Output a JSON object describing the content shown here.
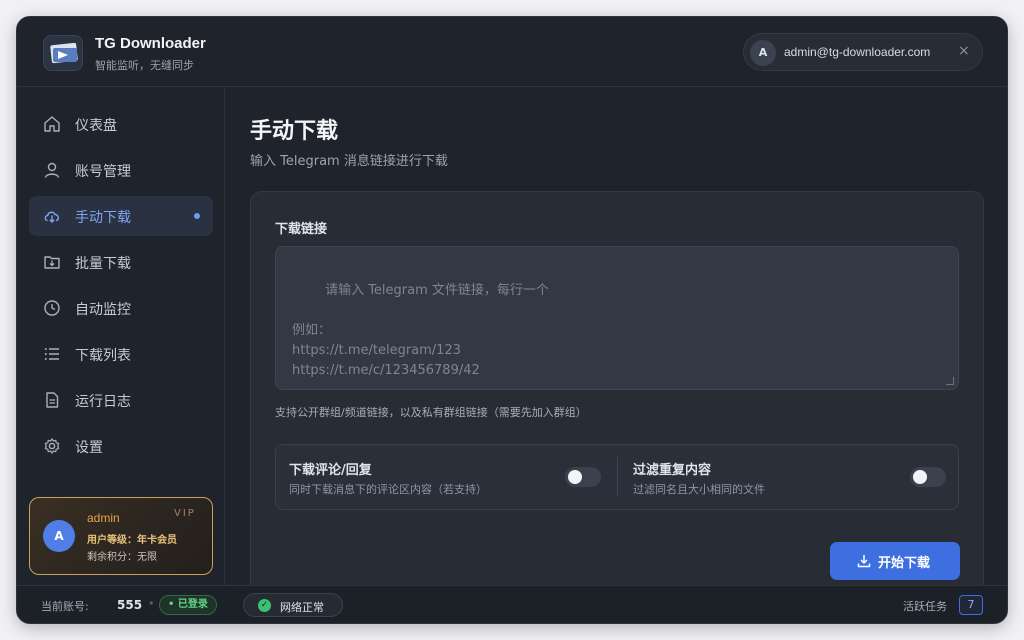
{
  "app": {
    "title": "TG Downloader",
    "subtitle": "智能监听，无缝同步"
  },
  "user": {
    "avatar_initial": "A",
    "email": "admin@tg-downloader.com",
    "close_glyph": "×"
  },
  "sidebar": {
    "items": [
      {
        "label": "仪表盘",
        "icon": "home-icon",
        "active": false
      },
      {
        "label": "账号管理",
        "icon": "user-icon",
        "active": false
      },
      {
        "label": "手动下载",
        "icon": "cloud-download-icon",
        "active": true
      },
      {
        "label": "批量下载",
        "icon": "folder-download-icon",
        "active": false
      },
      {
        "label": "自动监控",
        "icon": "clock-icon",
        "active": false
      },
      {
        "label": "下载列表",
        "icon": "list-icon",
        "active": false
      },
      {
        "label": "运行日志",
        "icon": "file-icon",
        "active": false
      },
      {
        "label": "设置",
        "icon": "gear-icon",
        "active": false
      }
    ]
  },
  "vip_card": {
    "avatar_initial": "A",
    "name": "admin",
    "tag": "VIP",
    "level": "用户等级：年卡会员",
    "credit": "剩余积分：无限"
  },
  "main": {
    "title": "手动下载",
    "subtitle": "输入 Telegram 消息链接进行下载",
    "link_label": "下载链接",
    "link_placeholder": "请输入 Telegram 文件链接，每行一个\n\n例如：\nhttps://t.me/telegram/123\nhttps://t.me/c/123456789/42",
    "link_value": "",
    "hint": "支持公开群组/频道链接，以及私有群组链接（需要先加入群组）",
    "options": [
      {
        "title": "下载评论/回复",
        "desc": "同时下载消息下的评论区内容（若支持）",
        "enabled": false
      },
      {
        "title": "过滤重复内容",
        "desc": "过滤同名且大小相同的文件",
        "enabled": false
      }
    ],
    "start_button": "开始下载"
  },
  "footer": {
    "account_label": "当前账号:",
    "account_value": "555",
    "separator": "•",
    "login_badge": "• 已登录",
    "network_status": "网络正常",
    "tasks_label": "活跃任务",
    "tasks_count": "7"
  },
  "colors": {
    "accent": "#3d6fe0",
    "active_nav_text": "#7ea7f5",
    "vip_gold": "#c9a25a",
    "ok_green": "#3cc26f"
  }
}
